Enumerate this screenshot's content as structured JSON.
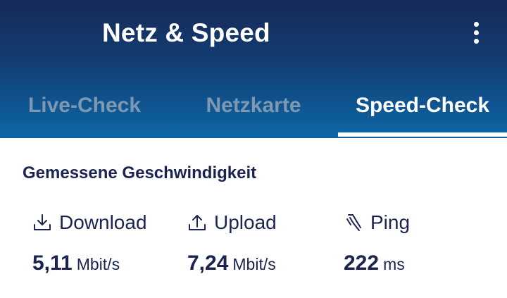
{
  "app": {
    "title": "Netz & Speed",
    "menu_icon": "more-vert-icon"
  },
  "tabs": [
    {
      "label": "Live-Check",
      "active": false
    },
    {
      "label": "Netzkarte",
      "active": false
    },
    {
      "label": "Speed-Check",
      "active": true
    }
  ],
  "speed": {
    "section_title": "Gemessene Geschwindigkeit",
    "metrics": [
      {
        "label": "Download",
        "icon": "download-icon",
        "value": "5,11",
        "unit": "Mbit/s"
      },
      {
        "label": "Upload",
        "icon": "upload-icon",
        "value": "7,24",
        "unit": "Mbit/s"
      },
      {
        "label": "Ping",
        "icon": "ping-icon",
        "value": "222",
        "unit": "ms"
      }
    ]
  },
  "colors": {
    "header_top": "#172a57",
    "header_bottom": "#0d67a6",
    "text_dark": "#1b2450",
    "tab_inactive": "#7c98b3",
    "tab_active": "#ffffff"
  }
}
